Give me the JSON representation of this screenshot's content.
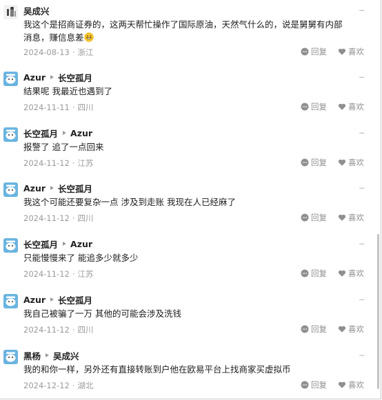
{
  "comments": [
    {
      "author": "吴成兴",
      "reply_to": "",
      "avatar": "photo-avatar",
      "text": "我这个是招商证券的，这两天帮忙操作了国际原油，天然气什么的，说是舅舅有内部消息，赚信息差",
      "emoji": "grinning-face",
      "date": "2024-08-13",
      "location": "浙江",
      "reply_label": "回复",
      "like_label": "喜欢"
    },
    {
      "author": "Azur",
      "reply_to": "长空孤月",
      "avatar": "cartoon-avatar",
      "text": "结果呢 我最近也遇到了",
      "date": "2024-11-11",
      "location": "四川",
      "reply_label": "回复",
      "like_label": "喜欢"
    },
    {
      "author": "长空孤月",
      "reply_to": "Azur",
      "avatar": "cartoon-avatar",
      "text": "报警了 追了一点回来",
      "date": "2024-11-12",
      "location": "江苏",
      "reply_label": "回复",
      "like_label": "喜欢"
    },
    {
      "author": "Azur",
      "reply_to": "长空孤月",
      "avatar": "cartoon-avatar",
      "text": "我这个可能还要复杂一点 涉及到走账 我现在人已经麻了",
      "date": "2024-11-12",
      "location": "四川",
      "reply_label": "回复",
      "like_label": "喜欢"
    },
    {
      "author": "长空孤月",
      "reply_to": "Azur",
      "avatar": "cartoon-avatar",
      "text": "只能慢慢来了 能追多少就多少",
      "date": "2024-11-12",
      "location": "江苏",
      "reply_label": "回复",
      "like_label": "喜欢"
    },
    {
      "author": "Azur",
      "reply_to": "长空孤月",
      "avatar": "cartoon-avatar",
      "text": "我自己被骗了一万 其他的可能会涉及洗钱",
      "date": "2024-11-12",
      "location": "四川",
      "reply_label": "回复",
      "like_label": "喜欢"
    },
    {
      "author": "黑杨",
      "reply_to": "吴成兴",
      "avatar": "cartoon-avatar",
      "text": "我的和你一样，另外还有直接转账到户他在欧易平台上找商家买虚拟币",
      "date": "2024-12-12",
      "location": "湖北",
      "reply_label": "回复",
      "like_label": "喜欢"
    }
  ],
  "icons": {
    "more": "more-horizontal-icon",
    "reply": "speech-bubble-icon",
    "like": "heart-icon",
    "reply_arrow": "caret-right-icon"
  },
  "colors": {
    "text": "#1c1c1c",
    "meta": "#9a9a9a",
    "avatar_blue": "#6ab4e0"
  }
}
